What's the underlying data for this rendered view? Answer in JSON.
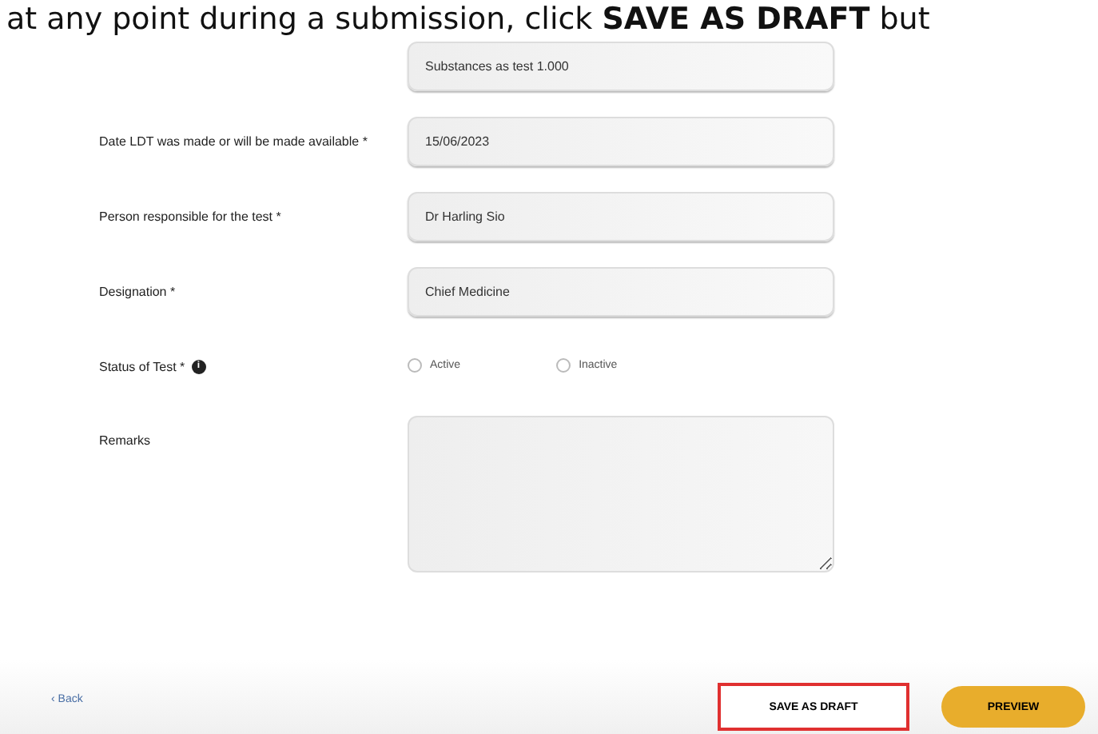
{
  "caption": "at any point during a submission, click **SAVE AS DRAFT** but",
  "fields": [
    {
      "kind": "input",
      "value": "Substances as test 1.000"
    },
    {
      "kind": "input",
      "label": "Date LDT was made or will be made available *",
      "value": "15/06/2023"
    },
    {
      "kind": "input",
      "label": "Person responsible for the test *",
      "value": "Dr Harling Sio"
    },
    {
      "kind": "input",
      "label": "Designation *",
      "value": "Chief Medicine"
    },
    {
      "kind": "radio",
      "label": "Status of Test *",
      "info": "i",
      "options": [
        {
          "label": "Active",
          "selected": false
        },
        {
          "label": "Inactive",
          "selected": false
        }
      ]
    },
    {
      "kind": "textarea",
      "label": "Remarks"
    }
  ],
  "footer": {
    "back": "‹ Back",
    "save": {
      "label": "SAVE AS DRAFT",
      "highlighted": true
    },
    "preview": "PREVIEW"
  }
}
